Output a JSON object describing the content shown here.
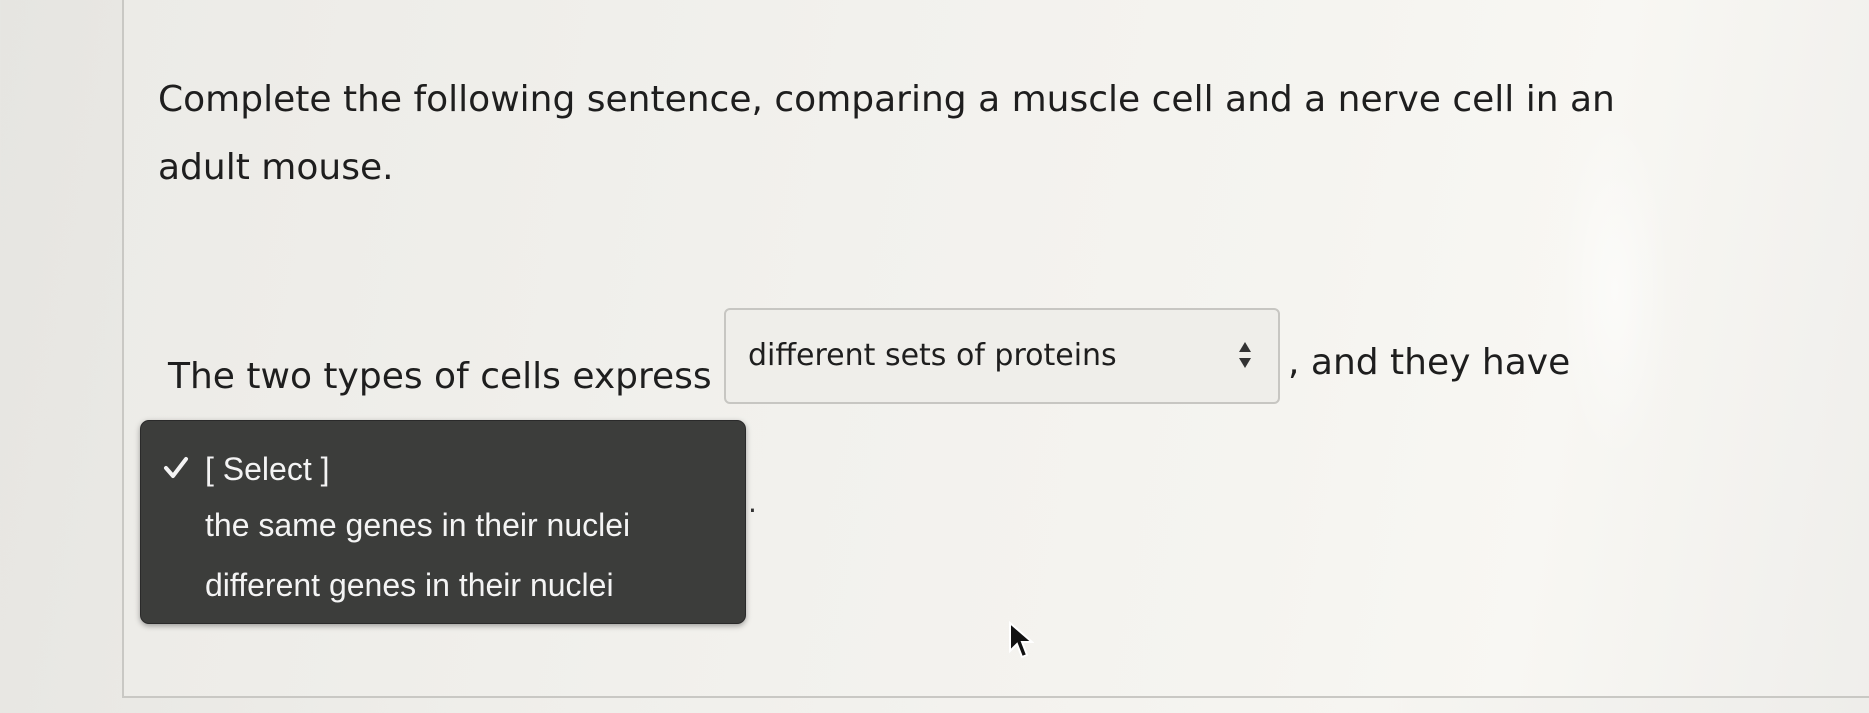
{
  "question": {
    "text": "Complete the following sentence, comparing a muscle cell and a nerve cell in an adult mouse."
  },
  "sentence": {
    "part1": "The two types of cells express",
    "part2": ", and they have",
    "end": "."
  },
  "select1": {
    "value": "different sets of proteins",
    "icon": "up-down-arrows-icon"
  },
  "dropdown": {
    "options": [
      {
        "label": "[ Select ]",
        "selected": true
      },
      {
        "label": "the same genes in their nuclei",
        "selected": false
      },
      {
        "label": "different genes in their nuclei",
        "selected": false
      }
    ],
    "check_icon": "checkmark-icon"
  },
  "colors": {
    "dropdown_bg": "#3c3d3b",
    "dropdown_text": "#f4f4f4",
    "page_bg": "#f2f1ed",
    "text": "#1e1e1e"
  }
}
